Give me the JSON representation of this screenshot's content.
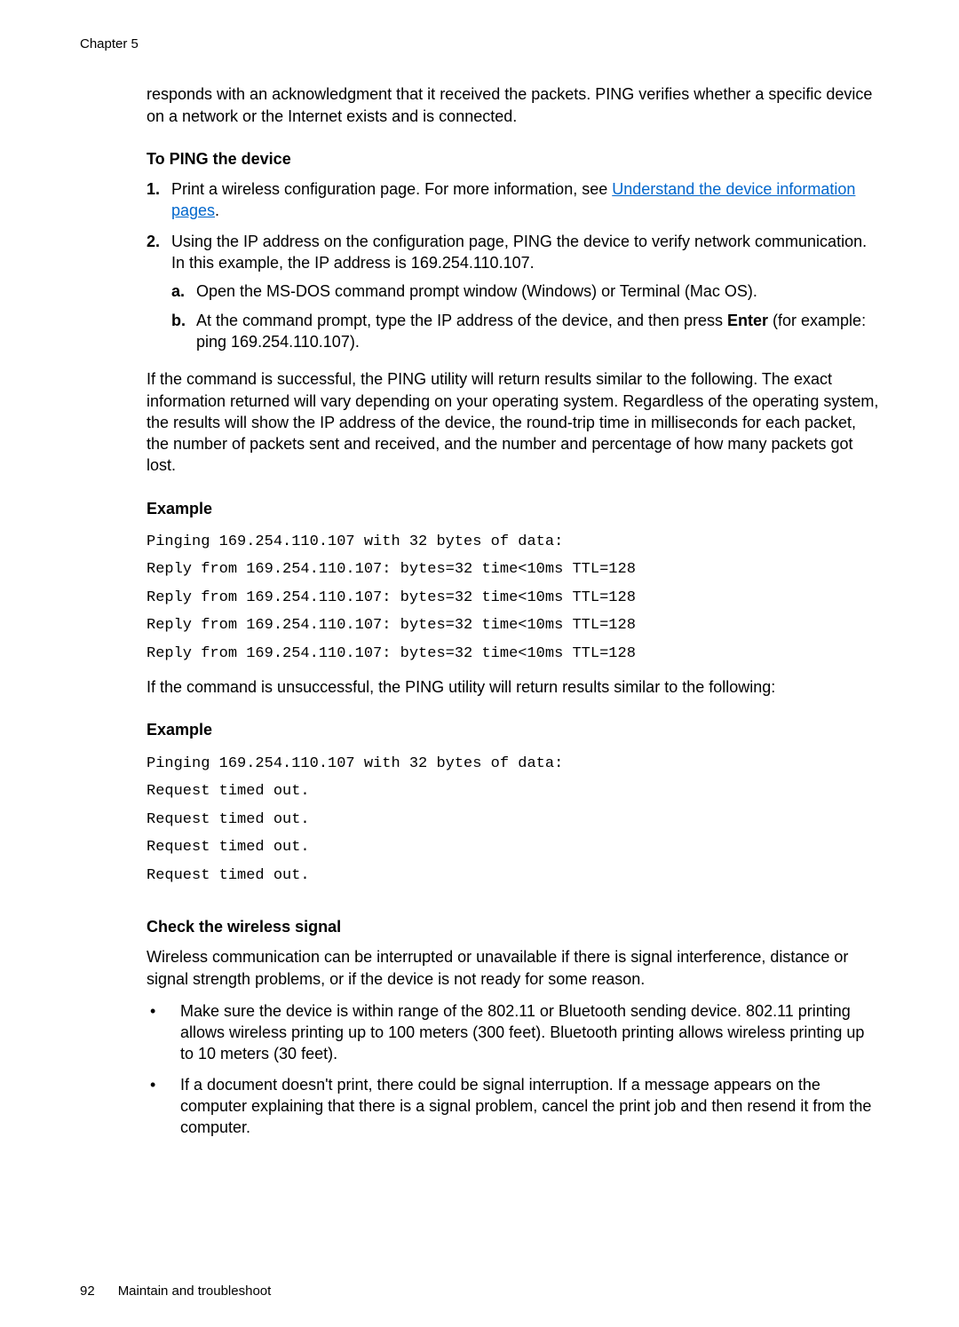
{
  "header": {
    "chapter": "Chapter 5"
  },
  "intro": "responds with an acknowledgment that it received the packets. PING verifies whether a specific device on a network or the Internet exists and is connected.",
  "ping": {
    "heading": "To PING the device",
    "step1": {
      "num": "1.",
      "text_before": "Print a wireless configuration page. For more information, see ",
      "link": "Understand the device information pages",
      "text_after": "."
    },
    "step2": {
      "num": "2.",
      "text": "Using the IP address on the configuration page, PING the device to verify network communication. In this example, the IP address is 169.254.110.107.",
      "a": {
        "marker": "a.",
        "text": "Open the MS-DOS command prompt window (Windows) or Terminal (Mac OS)."
      },
      "b": {
        "marker": "b.",
        "text_before": "At the command prompt, type the IP address of the device, and then press ",
        "bold": "Enter",
        "text_after": " (for example: ping 169.254.110.107)."
      }
    },
    "after_steps": "If the command is successful, the PING utility will return results similar to the following. The exact information returned will vary depending on your operating system. Regardless of the operating system, the results will show the IP address of the device, the round-trip time in milliseconds for each packet, the number of packets sent and received, and the number and percentage of how many packets got lost."
  },
  "example1": {
    "heading": "Example",
    "mono": "Pinging 169.254.110.107 with 32 bytes of data:\nReply from 169.254.110.107: bytes=32 time<10ms TTL=128\nReply from 169.254.110.107: bytes=32 time<10ms TTL=128\nReply from 169.254.110.107: bytes=32 time<10ms TTL=128\nReply from 169.254.110.107: bytes=32 time<10ms TTL=128",
    "after": "If the command is unsuccessful, the PING utility will return results similar to the following:"
  },
  "example2": {
    "heading": "Example",
    "mono": "Pinging 169.254.110.107 with 32 bytes of data:\nRequest timed out.\nRequest timed out.\nRequest timed out.\nRequest timed out."
  },
  "wireless": {
    "heading": "Check the wireless signal",
    "para": "Wireless communication can be interrupted or unavailable if there is signal interference, distance or signal strength problems, or if the device is not ready for some reason.",
    "bullets": [
      "Make sure the device is within range of the 802.11 or Bluetooth sending device. 802.11 printing allows wireless printing up to 100 meters (300 feet). Bluetooth printing allows wireless printing up to 10 meters (30 feet).",
      "If a document doesn't print, there could be signal interruption. If a message appears on the computer explaining that there is a signal problem, cancel the print job and then resend it from the computer."
    ]
  },
  "footer": {
    "page": "92",
    "title": "Maintain and troubleshoot"
  }
}
